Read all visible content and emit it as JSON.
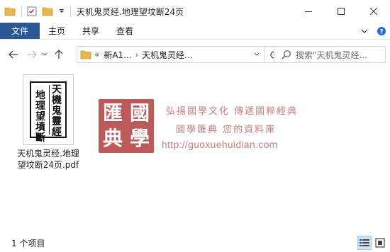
{
  "window": {
    "title": "天机鬼灵经.地理望坟断24页"
  },
  "ribbon": {
    "tabs": [
      {
        "label": "文件"
      },
      {
        "label": "主页"
      },
      {
        "label": "共享"
      },
      {
        "label": "查看"
      }
    ]
  },
  "address": {
    "overflow": "«",
    "crumbs": [
      {
        "label": "新A1..."
      },
      {
        "label": "天机鬼灵经..."
      }
    ]
  },
  "search": {
    "placeholder": "搜索\"天机鬼灵经..."
  },
  "file": {
    "name_line1": "天机鬼灵经.地理",
    "name_line2": "望坟断24页.pdf",
    "thumb_col1": "天機鬼靈經",
    "thumb_col2": "地理望墳斷"
  },
  "watermark": {
    "seal_chars": [
      "匯",
      "國",
      "典",
      "學"
    ],
    "line1": "弘揚國學文化  傳遞國粹經典",
    "line2": "國學匯典 您的資料庫",
    "url": "http://guoxuehuidian.com"
  },
  "status": {
    "count": "1 个项目"
  },
  "colors": {
    "file_tab": "#2b5797",
    "watermark_red": "#b54848",
    "folder_yellow": "#e8b64a"
  }
}
